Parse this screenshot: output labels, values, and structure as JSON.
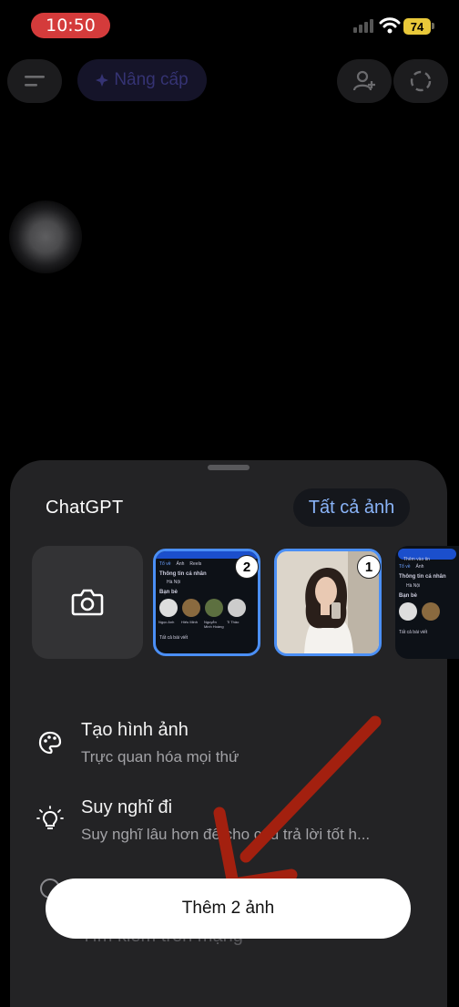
{
  "status_bar": {
    "time": "10:50",
    "battery": "74"
  },
  "top_bar": {
    "upgrade_label": "Nâng cấp"
  },
  "sheet": {
    "title": "ChatGPT",
    "all_photos_label": "Tất cả ảnh",
    "thumbnails": [
      {
        "badge": "2",
        "kind": "screenshot",
        "header": "Thông tin cá nhân",
        "location": "Hà Nội",
        "friends_label": "Bạn bè",
        "posts_label": "Tất cả bài viết",
        "tabs": [
          "Tổ về",
          "Ảnh",
          "Reels"
        ],
        "friends": [
          "Ngọc Anh",
          "Hiếu Minh",
          "Nguyễn Minh Hoàng",
          "Ti Thảo"
        ]
      },
      {
        "badge": "1",
        "kind": "photo"
      },
      {
        "kind": "screenshot",
        "header": "Thông tin cá nhân",
        "location": "Hà Nội",
        "friends_label": "Bạn bè",
        "posts_label": "Tất cả bài viết",
        "tabs": [
          "Tổ về",
          "Ảnh"
        ],
        "top_label": "Thêm vào tin"
      }
    ],
    "menu": [
      {
        "title": "Tạo hình ảnh",
        "subtitle": "Trực quan hóa mọi thứ",
        "icon": "palette-icon"
      },
      {
        "title": "Suy nghĩ đi",
        "subtitle": "Suy nghĩ lâu hơn để cho câu trả lời tốt h...",
        "icon": "lightbulb-icon"
      },
      {
        "title": "",
        "subtitle": "",
        "icon": "globe-icon"
      },
      {
        "title": "Tìm kiếm trên mạng",
        "subtitle": "",
        "icon": "search-icon"
      }
    ],
    "cta_label": "Thêm 2 ảnh"
  },
  "colors": {
    "accent": "#4b8ff5",
    "arrow": "#b0200f",
    "time_pill": "#d43b3b",
    "battery": "#e9c93a"
  }
}
